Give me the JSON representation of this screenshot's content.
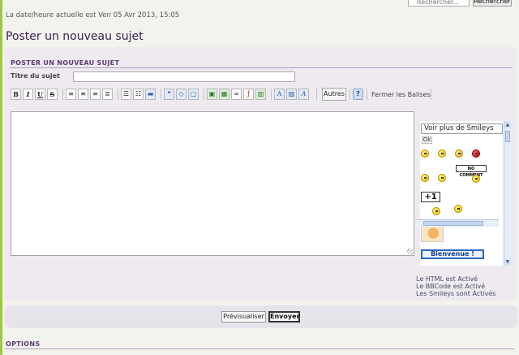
{
  "search": {
    "placeholder": "Rechercher...",
    "button_label": "Rechercher"
  },
  "header": {
    "datetime": "La date/heure actuelle est Ven 05 Avr 2013, 15:05",
    "title": "Poster un nouveau sujet"
  },
  "form": {
    "section_heading": "POSTER UN NOUVEAU SUJET",
    "subject_label": "Titre du sujet",
    "subject_value": "",
    "message_value": ""
  },
  "toolbar": {
    "bold": "B",
    "italic": "I",
    "underline": "U",
    "strike": "S",
    "autres_label": "Autres",
    "help_label": "?",
    "close_tags_label": "Fermer les Balises",
    "icons": [
      "bold-icon",
      "italic-icon",
      "underline-icon",
      "strikethrough-icon",
      "align-left-icon",
      "align-center-icon",
      "align-right-icon",
      "justify-icon",
      "bullet-list-icon",
      "numbered-list-icon",
      "horizontal-rule-icon",
      "quote-icon",
      "code-icon",
      "spoiler-icon",
      "image-icon",
      "upload-icon",
      "link-icon",
      "flash-icon",
      "video-icon",
      "font-icon",
      "color-icon",
      "size-icon",
      "help-icon"
    ]
  },
  "smileys": {
    "select_label": "Voir plus de Smileys",
    "ok_label": "Ok",
    "no_comment_text": "NO COMMENT",
    "plus_one_text": "+1",
    "bienvenue_text": "Bienvenue !"
  },
  "status": {
    "html": "Le HTML est Activé",
    "bbcode": "Le BBCode est Activé",
    "smileys": "Les Smileys sont Activés"
  },
  "actions": {
    "preview_label": "Prévisualiser",
    "submit_label": "Envoyer"
  },
  "options": {
    "heading": "OPTIONS"
  },
  "colors": {
    "accent_green": "#9fc93a",
    "title_purple": "#3b1f52",
    "panel_bg": "#eeeaf0",
    "rule": "#b49bc0"
  }
}
